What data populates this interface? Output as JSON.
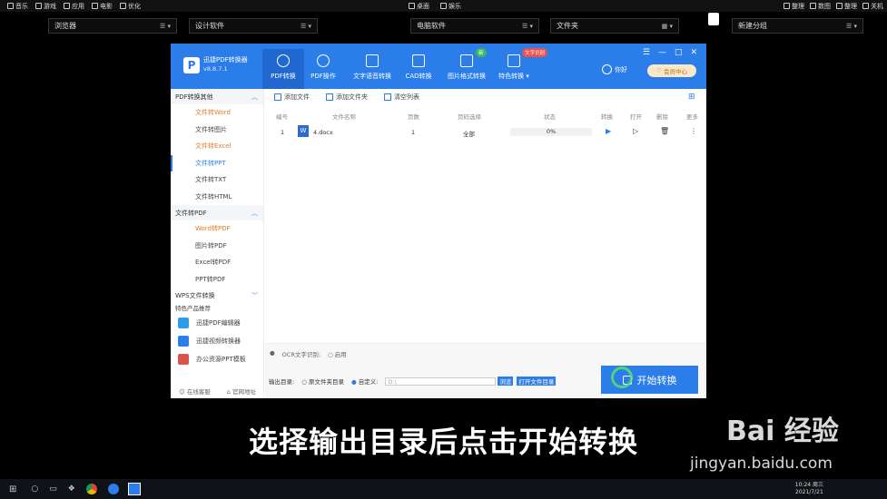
{
  "menubar": {
    "left": [
      {
        "label": "音乐",
        "icon": "music-icon"
      },
      {
        "label": "游戏",
        "icon": "gamepad-icon"
      },
      {
        "label": "应用",
        "icon": "apps-icon"
      },
      {
        "label": "电影",
        "icon": "film-icon"
      },
      {
        "label": "优化",
        "icon": "optimize-icon"
      }
    ],
    "center": [
      {
        "label": "桌面",
        "icon": "desktop-icon"
      },
      {
        "label": "娱乐",
        "icon": "entertainment-icon"
      }
    ],
    "right": [
      {
        "label": "整理",
        "icon": "organize-icon"
      },
      {
        "label": "数图",
        "icon": "image-icon"
      },
      {
        "label": "整理",
        "icon": "organize-icon"
      },
      {
        "label": "关机",
        "icon": "power-icon"
      }
    ]
  },
  "fences": [
    "浏览器",
    "设计软件",
    "电脑软件",
    "文件夹",
    "新建分组"
  ],
  "app": {
    "name": "迅捷PDF转换器",
    "version": "v8.8.7.1",
    "tabs": [
      {
        "label": "PDF转换",
        "icon": "pdf-convert-icon"
      },
      {
        "label": "PDF操作",
        "icon": "pdf-op-icon"
      },
      {
        "label": "文字语音转换",
        "icon": "voice-icon"
      },
      {
        "label": "CAD转换",
        "icon": "cad-icon"
      },
      {
        "label": "图片格式转换",
        "icon": "image-format-icon"
      },
      {
        "label": "特色转换 ▾",
        "icon": "special-icon"
      }
    ],
    "badge_new": "新",
    "badge_feature": "文字识别",
    "user": "你好",
    "member": "会员中心"
  },
  "sidebar": {
    "sections": [
      {
        "title": "PDF转换其他",
        "items": [
          {
            "label": "文件转Word",
            "hl": true
          },
          {
            "label": "文件转图片"
          },
          {
            "label": "文件转Excel",
            "hl": true
          },
          {
            "label": "文件转PPT",
            "sel": true
          },
          {
            "label": "文件转TXT"
          },
          {
            "label": "文件转HTML"
          }
        ]
      },
      {
        "title": "文件转PDF",
        "items": [
          {
            "label": "Word转PDF",
            "hl": true
          },
          {
            "label": "图片转PDF"
          },
          {
            "label": "Excel转PDF"
          },
          {
            "label": "PPT转PDF"
          }
        ]
      },
      {
        "title": "WPS文件转换",
        "items": []
      }
    ],
    "products_title": "特色产品推荐",
    "products": [
      {
        "label": "迅捷PDF编辑器",
        "color": "#2b9de9"
      },
      {
        "label": "迅捷视频转换器",
        "color": "#2b7de9"
      },
      {
        "label": "办公资源PPT模板",
        "color": "#d9534f"
      }
    ],
    "footer": [
      "在线客服",
      "官网地址"
    ]
  },
  "toolbar": [
    "添加文件",
    "添加文件夹",
    "清空列表"
  ],
  "table": {
    "headers": [
      "编号",
      "文件名称",
      "页数",
      "页码选择",
      "状态",
      "转换",
      "打开",
      "删除",
      "更多"
    ],
    "rows": [
      {
        "no": "1",
        "name": "4.docx",
        "pages": "1",
        "range": "全部",
        "progress": "0%"
      }
    ]
  },
  "ocr": {
    "label": "OCR文字识别:",
    "option": "启用"
  },
  "output": {
    "label": "输出目录:",
    "opt1": "原文件夹目录",
    "opt2": "自定义:",
    "path": "D:\\",
    "browse": "浏览",
    "open": "打开文件目录"
  },
  "start_button": "开始转换",
  "subtitle": "选择输出目录后点击开始转换",
  "watermark": {
    "brand": "Bai 经验",
    "url": "jingyan.baidu.com"
  },
  "clock": {
    "time": "10:24 周三",
    "date": "2021/7/21"
  }
}
